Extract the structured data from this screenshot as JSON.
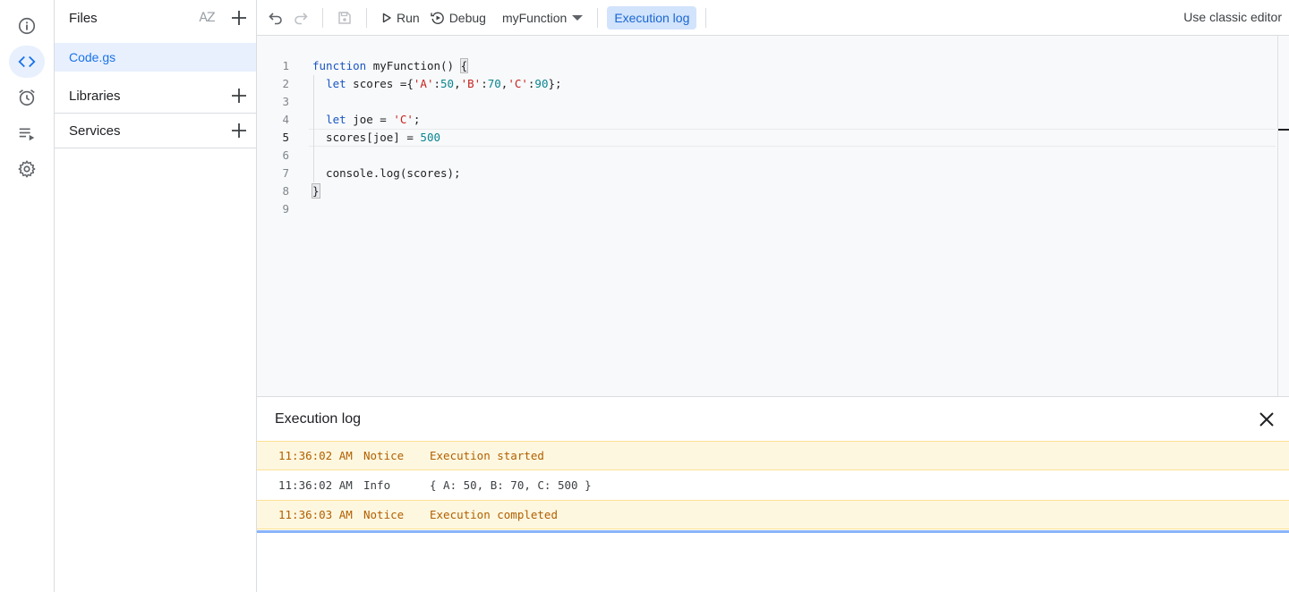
{
  "files_panel": {
    "title": "Files",
    "sort_icon_label": "AZ",
    "file_name": "Code.gs",
    "libraries_label": "Libraries",
    "services_label": "Services"
  },
  "toolbar": {
    "run_label": "Run",
    "debug_label": "Debug",
    "function_select": "myFunction",
    "exec_log_label": "Execution log",
    "classic_editor_label": "Use classic editor"
  },
  "editor": {
    "line_numbers": [
      "1",
      "2",
      "3",
      "4",
      "5",
      "6",
      "7",
      "8",
      "9"
    ],
    "current_line": 5
  },
  "exec_log": {
    "title": "Execution log",
    "rows": [
      {
        "time": "11:36:02 AM",
        "level": "Notice",
        "message": "Execution started"
      },
      {
        "time": "11:36:02 AM",
        "level": "Info",
        "message": "{ A: 50, B: 70, C: 500 }"
      },
      {
        "time": "11:36:03 AM",
        "level": "Notice",
        "message": "Execution completed"
      }
    ]
  },
  "colors": {
    "accent": "#1a73e8",
    "keyword": "#1a56c4",
    "string": "#c5221f",
    "number": "#098591",
    "notice_bg": "#fef7e0"
  },
  "icons": {
    "rail": [
      "info-icon",
      "code-icon",
      "alarm-clock-icon",
      "playlist-play-icon",
      "gear-icon"
    ],
    "toolbar": [
      "undo-icon",
      "redo-icon",
      "save-icon",
      "play-icon",
      "debug-icon"
    ]
  }
}
